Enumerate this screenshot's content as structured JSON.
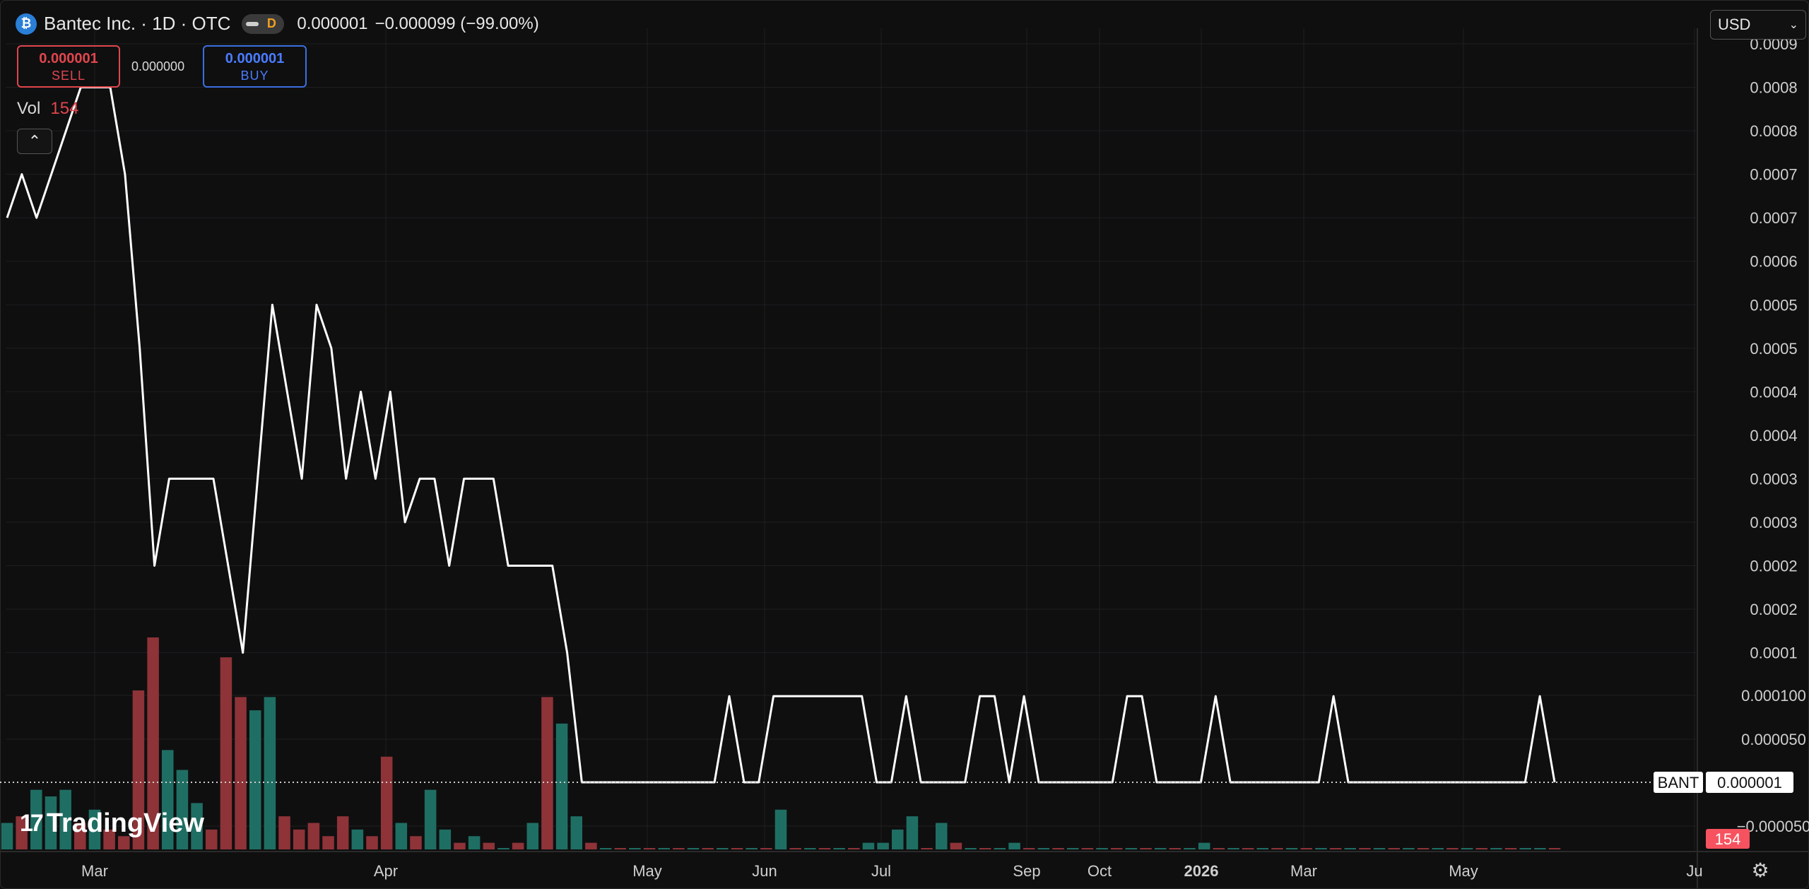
{
  "header": {
    "logo_icon": "bantec-logo-icon",
    "symbol_title": "Bantec Inc. · 1D · OTC",
    "badge": "D",
    "last_price": "0.000001",
    "change": "−0.000099 (−99.00%)"
  },
  "trade": {
    "sell_price": "0.000001",
    "sell_label": "SELL",
    "spread": "0.000000",
    "buy_price": "0.000001",
    "buy_label": "BUY"
  },
  "volume": {
    "label": "Vol",
    "value": "154"
  },
  "currency": {
    "selected": "USD"
  },
  "branding": {
    "name": "TradingView"
  },
  "colors": {
    "background": "#0f0f10",
    "line": "#ffffff",
    "up_volume": "#22ab94",
    "down_volume": "#f7525f",
    "sell": "#e0464d",
    "buy": "#3b6fe0"
  },
  "chart_data": {
    "type": "line",
    "y_axis_labels": [
      "0.0009",
      "0.0008",
      "0.0008",
      "0.0007",
      "0.0007",
      "0.0006",
      "0.0005",
      "0.0005",
      "0.0004",
      "0.0004",
      "0.0003",
      "0.0003",
      "0.0002",
      "0.0002",
      "0.0001",
      "0.000100",
      "0.000050",
      "−0.000050"
    ],
    "y_axis_values": [
      0.00085,
      0.0008,
      0.00075,
      0.0007,
      0.00065,
      0.0006,
      0.00055,
      0.0005,
      0.00045,
      0.0004,
      0.00035,
      0.0003,
      0.00025,
      0.0002,
      0.00015,
      0.0001,
      5e-05,
      -5e-05
    ],
    "x_axis_labels": [
      "Mar",
      "Apr",
      "May",
      "Jun",
      "Jul",
      "Sep",
      "Oct",
      "2026",
      "Mar",
      "May",
      "Ju"
    ],
    "price_tag": {
      "symbol": "BANT",
      "value": "0.000001"
    },
    "volume_tag": "154",
    "ylim": [
      -8e-05,
      0.00087
    ],
    "series": [
      {
        "values": [
          0.00065,
          0.0007,
          0.00065,
          0.0007,
          0.00075,
          0.0008,
          0.0008,
          0.0008,
          0.0007,
          0.0005,
          0.00025,
          0.00035,
          0.00035,
          0.00035,
          0.00035,
          0.00025,
          0.00015,
          0.00035,
          0.00055,
          0.00045,
          0.00035,
          0.00055,
          0.0005,
          0.00035,
          0.00045,
          0.00035,
          0.00045,
          0.0003,
          0.00035,
          0.00035,
          0.00025,
          0.00035,
          0.00035,
          0.00035,
          0.00025,
          0.00025,
          0.00025,
          0.00025,
          0.00015,
          1e-06,
          1e-06,
          1e-06,
          1e-06,
          1e-06,
          1e-06,
          1e-06,
          1e-06,
          1e-06,
          1e-06,
          0.0001,
          1e-06,
          1e-06,
          0.0001,
          0.0001,
          0.0001,
          0.0001,
          0.0001,
          0.0001,
          0.0001,
          1e-06,
          1e-06,
          0.0001,
          1e-06,
          1e-06,
          1e-06,
          1e-06,
          0.0001,
          0.0001,
          1e-06,
          0.0001,
          1e-06,
          1e-06,
          1e-06,
          1e-06,
          1e-06,
          1e-06,
          0.0001,
          0.0001,
          1e-06,
          1e-06,
          1e-06,
          1e-06,
          0.0001,
          1e-06,
          1e-06,
          1e-06,
          1e-06,
          1e-06,
          1e-06,
          1e-06,
          0.0001,
          1e-06,
          1e-06,
          1e-06,
          1e-06,
          1e-06,
          1e-06,
          1e-06,
          1e-06,
          1e-06,
          1e-06,
          1e-06,
          1e-06,
          1e-06,
          0.0001,
          1e-06
        ]
      }
    ],
    "volume": {
      "values": [
        4,
        5,
        9,
        8,
        9,
        4,
        6,
        3,
        2,
        24,
        32,
        15,
        12,
        7,
        3,
        29,
        23,
        21,
        23,
        5,
        3,
        4,
        2,
        5,
        3,
        2,
        14,
        4,
        2,
        9,
        3,
        1,
        2,
        1,
        0,
        1,
        4,
        23,
        19,
        5,
        1,
        0,
        0,
        0,
        0,
        0,
        0,
        0,
        0,
        0,
        0,
        0,
        0,
        6,
        0,
        0,
        0,
        0,
        0,
        1,
        1,
        3,
        5,
        0,
        4,
        1,
        0,
        0,
        0,
        1,
        0,
        0,
        0,
        0,
        0,
        0,
        0,
        0,
        0,
        0,
        0,
        0,
        1,
        0,
        0,
        0,
        0,
        0,
        0,
        0,
        0,
        0,
        0,
        0,
        0,
        0,
        0,
        0,
        0,
        0,
        0,
        0,
        0,
        0,
        0,
        0,
        0
      ],
      "direction": [
        "up",
        "down",
        "up",
        "up",
        "up",
        "down",
        "up",
        "down",
        "down",
        "down",
        "down",
        "up",
        "up",
        "up",
        "down",
        "down",
        "down",
        "up",
        "up",
        "down",
        "down",
        "down",
        "down",
        "down",
        "up",
        "down",
        "down",
        "up",
        "down",
        "up",
        "up",
        "down",
        "up",
        "down",
        "up",
        "down",
        "up",
        "down",
        "up",
        "up",
        "down",
        "up",
        "down",
        "up",
        "down",
        "up",
        "down",
        "up",
        "down",
        "up",
        "down",
        "up",
        "down",
        "up",
        "down",
        "up",
        "down",
        "up",
        "down",
        "up",
        "up",
        "up",
        "up",
        "down",
        "up",
        "down",
        "up",
        "down",
        "up",
        "up",
        "down",
        "up",
        "down",
        "up",
        "down",
        "up",
        "down",
        "up",
        "down",
        "up",
        "down",
        "up",
        "up",
        "down",
        "up",
        "down",
        "up",
        "down",
        "up",
        "down",
        "up",
        "down",
        "up",
        "down",
        "up",
        "down",
        "up",
        "down",
        "up",
        "down",
        "up",
        "down",
        "up",
        "down",
        "up",
        "up"
      ]
    }
  }
}
